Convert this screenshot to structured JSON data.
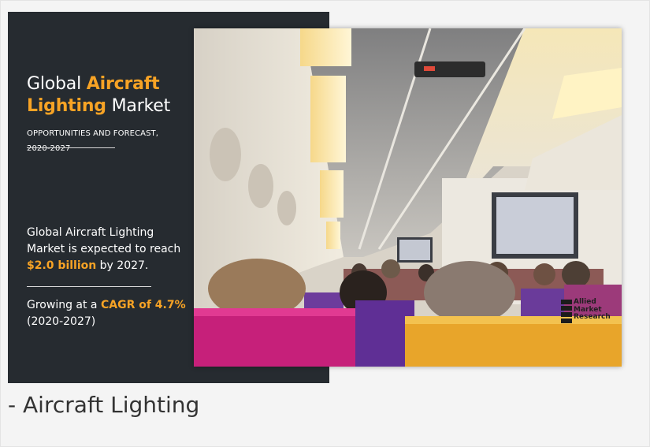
{
  "banner": {
    "title_prefix": "Global ",
    "title_highlight_1": "Aircraft",
    "title_highlight_2": "Lighting",
    "title_suffix": " Market",
    "subtitle_line1": "OPPORTUNITIES AND FORECAST,",
    "subtitle_line2": "2020-2027",
    "market_line1": "Global Aircraft Lighting",
    "market_line2": "Market is expected to reach",
    "market_value": "$2.0 billion",
    "market_suffix": " by 2027.",
    "growth_prefix": "Growing at a ",
    "growth_value": "CAGR of 4.7%",
    "growth_period": "(2020-2027)"
  },
  "logo": {
    "line1": "Allied",
    "line2": "Market",
    "line3": "Research"
  },
  "caption": "- Aircraft Lighting",
  "colors": {
    "accent": "#f7a325",
    "banner_background": "#262b30",
    "page_background": "#f4f4f4"
  }
}
